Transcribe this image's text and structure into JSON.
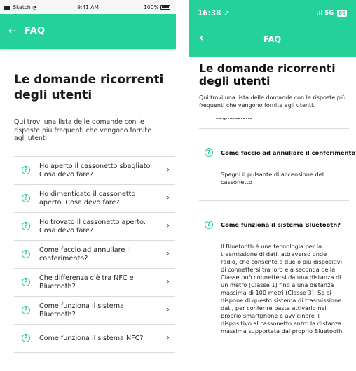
{
  "left": {
    "status": {
      "carrier": "Sketch",
      "time": "9:41 AM",
      "battery": "100%"
    },
    "header": {
      "back_icon": "←",
      "title": "FAQ"
    },
    "heading": "Le domande ricorrenti degli utenti",
    "intro": "Qui trovi una lista delle domande con le risposte più frequenti che vengono fornite agli utenti.",
    "items": [
      {
        "icon": "?",
        "text": "Ho aperto il cassonetto sbagliato. Cosa devo fare?",
        "chevron": "›"
      },
      {
        "icon": "?",
        "text": "Ho dimenticato il cassonetto aperto. Cosa devo fare?",
        "chevron": "›"
      },
      {
        "icon": "?",
        "text": "Ho trovato il cassonetto aperto. Cosa devo fare?",
        "chevron": "›"
      },
      {
        "icon": "?",
        "text": "Come faccio ad annullare il conferimento?",
        "chevron": "›"
      },
      {
        "icon": "?",
        "text": "Che differenza c'è tra NFC e Bluetooth?",
        "chevron": "›"
      },
      {
        "icon": "?",
        "text": "Come funziona il sistema Bluetooth?",
        "chevron": "›"
      },
      {
        "icon": "?",
        "text": "Come funziona il sistema NFC?",
        "chevron": "›"
      }
    ]
  },
  "right": {
    "status": {
      "time": "16:38 ➚",
      "network": ".ıl 5G",
      "battery": "86"
    },
    "header": {
      "back_icon": "‹",
      "title": "FAQ"
    },
    "heading": "Le domande ricorrenti degli utenti",
    "intro": "Qui trovi una lista delle domande con le risposte più frequenti che vengono fornite agli utenti.",
    "cut_text": "segnalazione",
    "faqs": [
      {
        "icon": "?",
        "question": "Come faccio ad annullare il conferimento?",
        "answer": "Spegni il pulsante di accensione del cassonetto"
      },
      {
        "icon": "?",
        "question": "Come funziona il sistema Bluetooth?",
        "answer": "Il Bluetooth è una tecnologia per la trasmissione di dati, attraverso onde radio, che consente a due o più dispositivi di connettersi tra loro e a seconda della Classe può connettersi da una distanza di un metro (Classe 1) fino a una distanza massima di 100 metri (Classe 3). Se si dispone di questo sistema di trasmissione dati, per conferire basta attivarlo nel proprio smartphone e avvicinare il dispositivo al cassonetto entro la distanza massima supportata dal proprio Bluetooth."
      }
    ]
  },
  "colors": {
    "accent": "#23d199",
    "divider": "#dadada"
  },
  "icons": {
    "back": "arrow-left-icon",
    "faq_item": "question-circle-icon",
    "chevron": "chevron-right-icon"
  }
}
